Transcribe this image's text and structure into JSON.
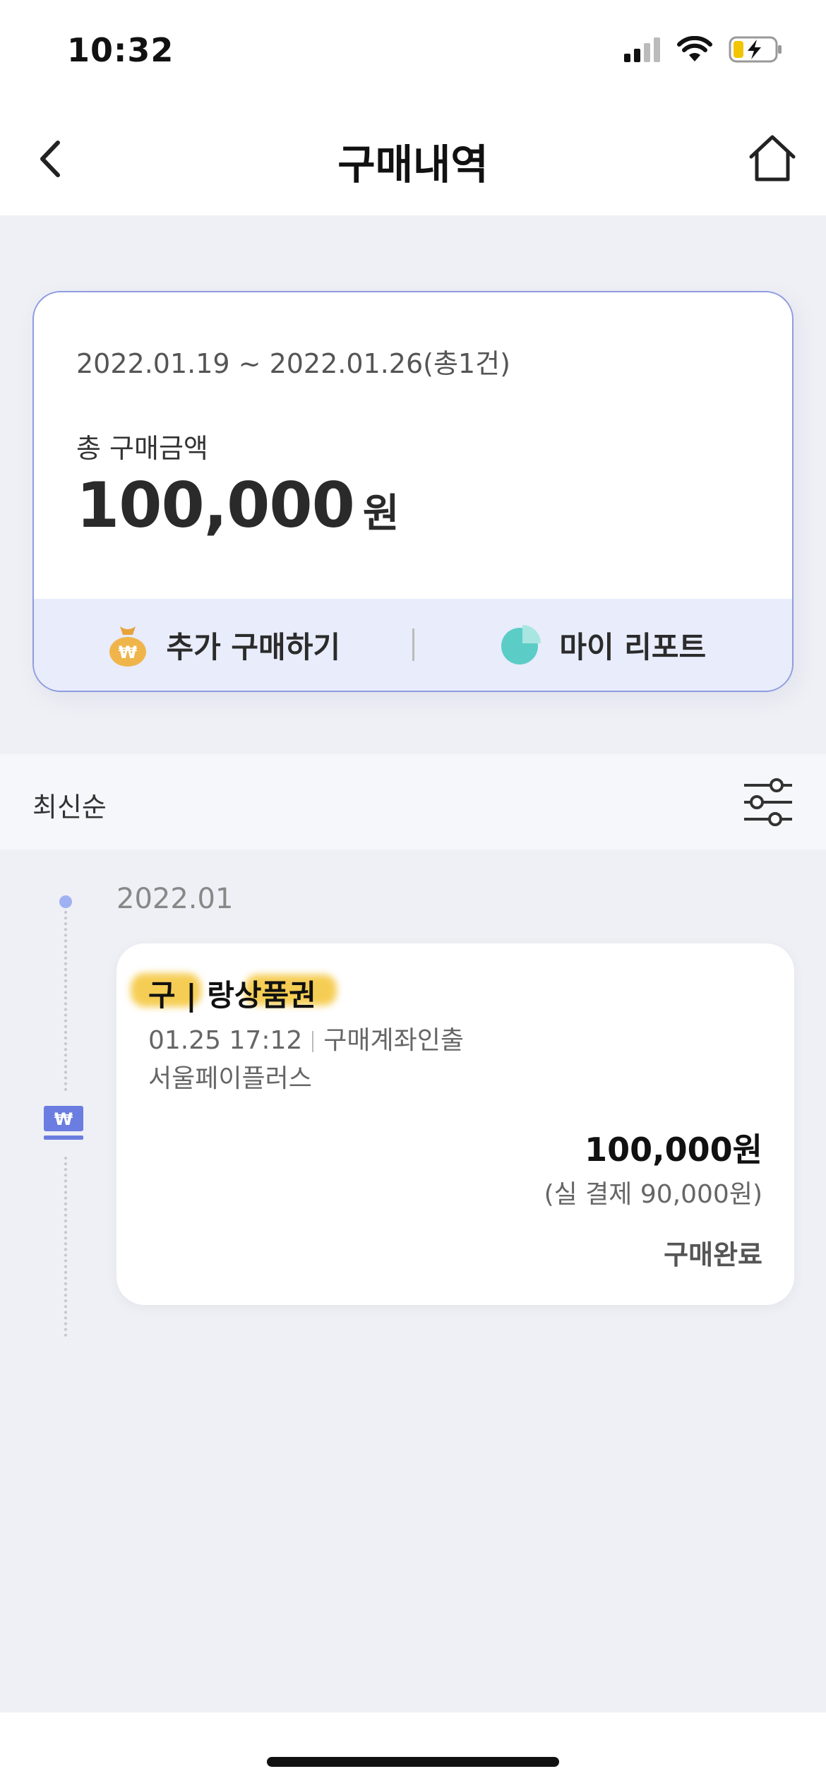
{
  "status_bar": {
    "time": "10:32"
  },
  "header": {
    "title": "구매내역",
    "back_icon": "chevron-left-icon",
    "home_icon": "home-icon"
  },
  "summary": {
    "period": "2022.01.19 ~ 2022.01.26(총1건)",
    "total_label": "총 구매금액",
    "total_amount": "100,000",
    "total_unit": "원",
    "actions": [
      {
        "label": "추가 구매하기",
        "icon": "money-bag-icon"
      },
      {
        "label": "마이 리포트",
        "icon": "pie-chart-icon"
      }
    ],
    "accent": "#8f9ce0"
  },
  "sort": {
    "label": "최신순",
    "icon": "filter-sliders-icon"
  },
  "timeline": {
    "month": "2022.01",
    "items": [
      {
        "title": "구 | 랑상품권",
        "date_time": "01.25 17:12",
        "method": "구매계좌인출",
        "merchant": "서울페이플러스",
        "amount": "100,000원",
        "actual_payment": "(실 결제 90,000원)",
        "status": "구매완료"
      }
    ]
  }
}
